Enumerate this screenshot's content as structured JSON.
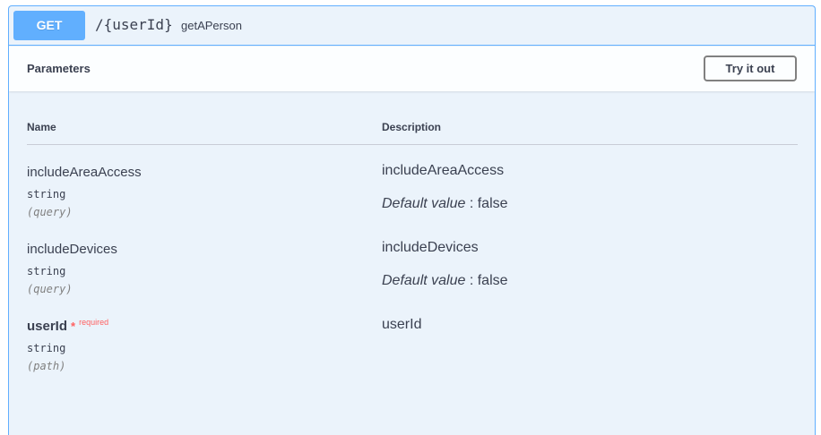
{
  "operation": {
    "method": "GET",
    "path": "/{userId}",
    "description": "getAPerson"
  },
  "parameters_section": {
    "title": "Parameters",
    "try_button_label": "Try it out"
  },
  "table": {
    "headers": {
      "name": "Name",
      "description": "Description"
    },
    "default_label": "Default value",
    "default_separator": " : ",
    "required_label": "required",
    "required_star": "*",
    "rows": [
      {
        "name": "includeAreaAccess",
        "type": "string",
        "in": "(query)",
        "description": "includeAreaAccess",
        "default": "false",
        "required": false
      },
      {
        "name": "includeDevices",
        "type": "string",
        "in": "(query)",
        "description": "includeDevices",
        "default": "false",
        "required": false
      },
      {
        "name": "userId",
        "type": "string",
        "in": "(path)",
        "description": "userId",
        "default": null,
        "required": true
      }
    ]
  },
  "colors": {
    "accent": "#61affe",
    "block_background": "#ebf3fb",
    "required": "#ff6060",
    "text": "#3b4151"
  }
}
